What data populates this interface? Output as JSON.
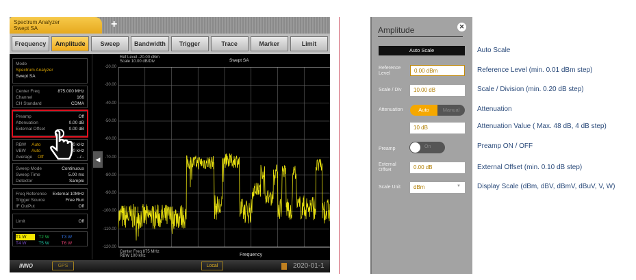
{
  "analyzer": {
    "tab_title": "Spectrum Analyzer",
    "tab_subtitle": "Swept SA",
    "add_tab": "+",
    "menu": [
      "Frequency",
      "Amplitude",
      "Sweep",
      "Bandwidth",
      "Trigger",
      "Trace",
      "Marker",
      "Limit"
    ],
    "active_menu": "Amplitude",
    "sidebar": {
      "mode_label": "Mode",
      "mode_value": "Spectrum Analyzer",
      "mode_sub": "Swept SA",
      "freq": [
        [
          "Center Freq",
          "875.000 MHz"
        ],
        [
          "Channel",
          "166"
        ],
        [
          "CH Standard",
          "CDMA"
        ]
      ],
      "amp": [
        [
          "Preamp",
          "Off"
        ],
        [
          "Attenuation",
          "0.00 dB"
        ],
        [
          "External Offset",
          "0.00 dB"
        ]
      ],
      "bw": [
        [
          "RBW",
          "Auto",
          "100 kHz"
        ],
        [
          "VBW",
          "Auto",
          "100 kHz"
        ],
        [
          "Average",
          "Off",
          "--/--"
        ]
      ],
      "sweep": [
        [
          "Sweep Mode",
          "Continuous"
        ],
        [
          "Sweep Time",
          "5.00 ms"
        ],
        [
          "Detector",
          "Sample"
        ]
      ],
      "ref": [
        [
          "Freq Reference",
          "External 10MHz"
        ],
        [
          "Trigger Source",
          "Free Run"
        ],
        [
          "IF OutPut",
          "Off"
        ]
      ],
      "limit": [
        "Limit",
        "Off"
      ],
      "traces": [
        {
          "label": "T1 W",
          "color": "#000",
          "bg": "#f3e600"
        },
        {
          "label": "T2 W",
          "color": "#20c050"
        },
        {
          "label": "T3 W",
          "color": "#3070e0"
        },
        {
          "label": "T4 W",
          "color": "#8050d0"
        },
        {
          "label": "T5 W",
          "color": "#20c0a0"
        },
        {
          "label": "T6 W",
          "color": "#e04070"
        }
      ]
    },
    "plot": {
      "ref_level": "Ref Level -20.00 dBm",
      "scale": "Scale 10.00 dB/Div",
      "title": "Swept SA",
      "yticks": [
        "-20.00",
        "-30.00",
        "-40.00",
        "-50.00",
        "-60.00",
        "-70.00",
        "-80.00",
        "-90.00",
        "-100.00",
        "-110.00",
        "-120.00"
      ],
      "center": "Center Freq  875 MHz",
      "rbw": "RBW 100 kHz",
      "xlabel": "Frequency",
      "trace_color": "#e8e010"
    },
    "status": {
      "logo": "INNO",
      "gps": "GPS",
      "local": "Local",
      "datetime": "2020-01-1"
    }
  },
  "panel": {
    "title": "Amplitude",
    "close": "✕",
    "auto_scale": "Auto Scale",
    "ref_level_label": "Reference Level",
    "ref_level": "0.00 dBm",
    "scale_label": "Scale / Div",
    "scale": "10.00 dB",
    "atten_label": "Attenuation",
    "atten_auto": "Auto",
    "atten_manual": "Manual",
    "atten_value": "10 dB",
    "preamp_label": "Preamp",
    "preamp_state": "On",
    "offset_label": "External Offset",
    "offset": "0.00 dB",
    "unit_label": "Scale Unit",
    "unit": "dBm"
  },
  "annotations": [
    "Auto Scale",
    "Reference Level (min. 0.01 dBm step)",
    "Scale / Division (min. 0.20 dB step)",
    "Attenuation",
    "Attenuation Value ( Max. 48 dB, 4 dB step)",
    "Preamp ON / OFF",
    "External Offset (min. 0.10 dB step)",
    "Display Scale (dBm, dBV, dBmV, dBuV, V, W)"
  ]
}
